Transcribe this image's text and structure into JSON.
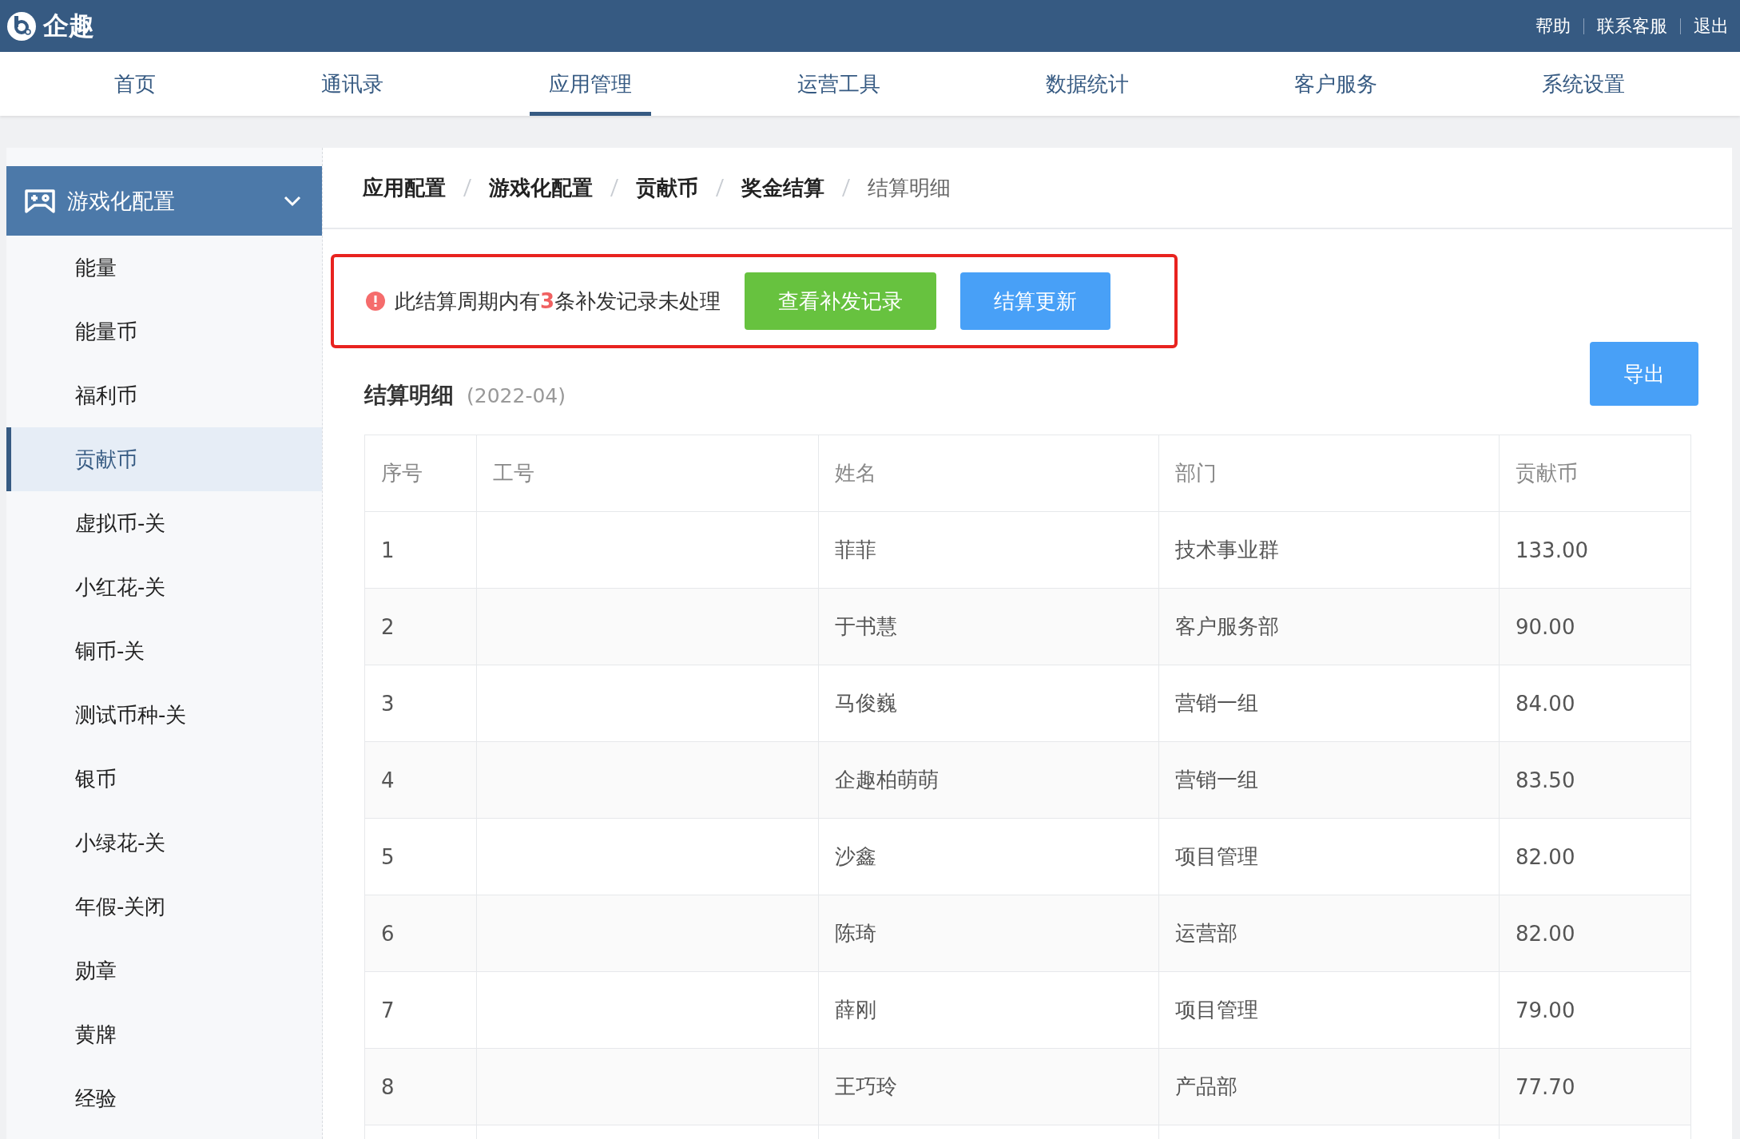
{
  "header": {
    "logo": "企趣",
    "links": [
      "帮助",
      "联系客服",
      "退出"
    ]
  },
  "nav": [
    {
      "label": "首页",
      "selected": false
    },
    {
      "label": "通讯录",
      "selected": false
    },
    {
      "label": "应用管理",
      "selected": true
    },
    {
      "label": "运营工具",
      "selected": false
    },
    {
      "label": "数据统计",
      "selected": false
    },
    {
      "label": "客户服务",
      "selected": false
    },
    {
      "label": "系统设置",
      "selected": false
    }
  ],
  "sidebar": {
    "group": {
      "label": "游戏化配置",
      "expanded": true
    },
    "items": [
      {
        "label": "能量",
        "selected": false
      },
      {
        "label": "能量币",
        "selected": false
      },
      {
        "label": "福利币",
        "selected": false
      },
      {
        "label": "贡献币",
        "selected": true
      },
      {
        "label": "虚拟币-关",
        "selected": false
      },
      {
        "label": "小红花-关",
        "selected": false
      },
      {
        "label": "铜币-关",
        "selected": false
      },
      {
        "label": "测试币种-关",
        "selected": false
      },
      {
        "label": "银币",
        "selected": false
      },
      {
        "label": "小绿花-关",
        "selected": false
      },
      {
        "label": "年假-关闭",
        "selected": false
      },
      {
        "label": "勋章",
        "selected": false
      },
      {
        "label": "黄牌",
        "selected": false
      },
      {
        "label": "经验",
        "selected": false
      }
    ]
  },
  "breadcrumb": [
    "应用配置",
    "游戏化配置",
    "贡献币",
    "奖金结算",
    "结算明细"
  ],
  "alert": {
    "message": "此结算周期内有**3**条补发记录未处理",
    "buttons": [
      {
        "label": "查看补发记录",
        "kind": "success"
      },
      {
        "label": "结算更新",
        "kind": "primary"
      }
    ]
  },
  "section": {
    "title": "结算明细",
    "period": "(2022-04)",
    "export_button": "导出"
  },
  "table": {
    "columns": [
      "序号",
      "工号",
      "姓名",
      "部门",
      "贡献币"
    ],
    "rows": [
      [
        "1",
        "",
        "菲菲",
        "技术事业群",
        "133.00"
      ],
      [
        "2",
        "",
        "于书慧",
        "客户服务部",
        "90.00"
      ],
      [
        "3",
        "",
        "马俊巍",
        "营销一组",
        "84.00"
      ],
      [
        "4",
        "",
        "企趣柏萌萌",
        "营销一组",
        "83.50"
      ],
      [
        "5",
        "",
        "沙鑫",
        "项目管理",
        "82.00"
      ],
      [
        "6",
        "",
        "陈琦",
        "运营部",
        "82.00"
      ],
      [
        "7",
        "",
        "薛刚",
        "项目管理",
        "79.00"
      ],
      [
        "8",
        "",
        "王巧玲",
        "产品部",
        "77.70"
      ]
    ]
  }
}
